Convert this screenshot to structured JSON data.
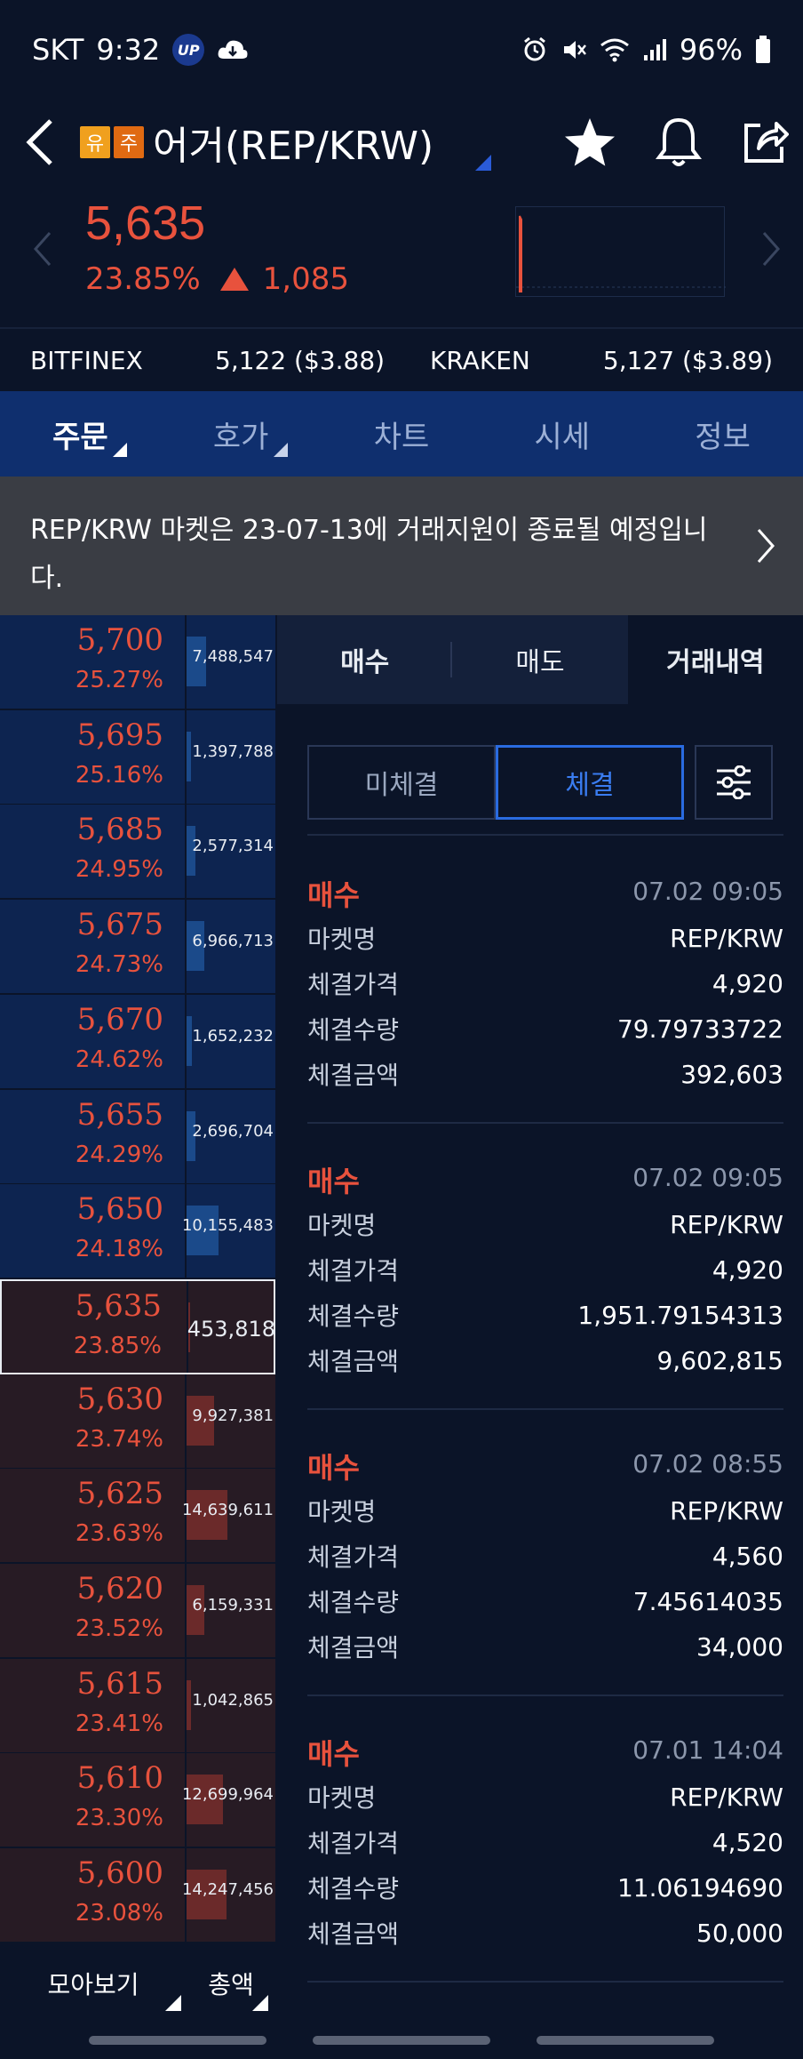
{
  "status": {
    "carrier": "SKT",
    "time": "9:32",
    "up_badge": "UP",
    "battery": "96%"
  },
  "header": {
    "badge1": "유",
    "badge2": "주",
    "title": "어거(REP/KRW)"
  },
  "price": {
    "current": "5,635",
    "change_pct": "23.85%",
    "change_amt": "1,085"
  },
  "exchanges": [
    {
      "name": "BITFINEX",
      "value": "5,122 ($3.88)"
    },
    {
      "name": "KRAKEN",
      "value": "5,127 ($3.89)"
    }
  ],
  "tabs": [
    "주문",
    "호가",
    "차트",
    "시세",
    "정보"
  ],
  "notice": {
    "text": "REP/KRW 마켓은 23-07-13에 거래지원이 종료될 예정입니다."
  },
  "orderbook": [
    {
      "price": "5,700",
      "pct": "25.27%",
      "vol": "7,488,547",
      "side": "ask",
      "bar": 0.22
    },
    {
      "price": "5,695",
      "pct": "25.16%",
      "vol": "1,397,788",
      "side": "ask",
      "bar": 0.05
    },
    {
      "price": "5,685",
      "pct": "24.95%",
      "vol": "2,577,314",
      "side": "ask",
      "bar": 0.1
    },
    {
      "price": "5,675",
      "pct": "24.73%",
      "vol": "6,966,713",
      "side": "ask",
      "bar": 0.2
    },
    {
      "price": "5,670",
      "pct": "24.62%",
      "vol": "1,652,232",
      "side": "ask",
      "bar": 0.06
    },
    {
      "price": "5,655",
      "pct": "24.29%",
      "vol": "2,696,704",
      "side": "ask",
      "bar": 0.1
    },
    {
      "price": "5,650",
      "pct": "24.18%",
      "vol": "10,155,483",
      "side": "ask",
      "bar": 0.35
    },
    {
      "price": "5,635",
      "pct": "23.85%",
      "vol": "453,818",
      "side": "bid",
      "bar": 0.02,
      "current": true
    },
    {
      "price": "5,630",
      "pct": "23.74%",
      "vol": "9,927,381",
      "side": "bid",
      "bar": 0.3
    },
    {
      "price": "5,625",
      "pct": "23.63%",
      "vol": "14,639,611",
      "side": "bid",
      "bar": 0.45
    },
    {
      "price": "5,620",
      "pct": "23.52%",
      "vol": "6,159,331",
      "side": "bid",
      "bar": 0.2
    },
    {
      "price": "5,615",
      "pct": "23.41%",
      "vol": "1,042,865",
      "side": "bid",
      "bar": 0.05
    },
    {
      "price": "5,610",
      "pct": "23.30%",
      "vol": "12,699,964",
      "side": "bid",
      "bar": 0.4
    },
    {
      "price": "5,600",
      "pct": "23.08%",
      "vol": "14,247,456",
      "side": "bid",
      "bar": 0.44
    }
  ],
  "ob_footer": {
    "collect": "모아보기",
    "total": "총액"
  },
  "subtabs": [
    "매수",
    "매도",
    "거래내역"
  ],
  "filters": {
    "pending": "미체결",
    "filled": "체결"
  },
  "trade_labels": {
    "market": "마켓명",
    "price": "체결가격",
    "qty": "체결수량",
    "amount": "체결금액"
  },
  "trades": [
    {
      "type": "매수",
      "time": "07.02 09:05",
      "market": "REP/KRW",
      "price": "4,920",
      "qty": "79.79733722",
      "amount": "392,603"
    },
    {
      "type": "매수",
      "time": "07.02 09:05",
      "market": "REP/KRW",
      "price": "4,920",
      "qty": "1,951.79154313",
      "amount": "9,602,815"
    },
    {
      "type": "매수",
      "time": "07.02 08:55",
      "market": "REP/KRW",
      "price": "4,560",
      "qty": "7.45614035",
      "amount": "34,000"
    },
    {
      "type": "매수",
      "time": "07.01 14:04",
      "market": "REP/KRW",
      "price": "4,520",
      "qty": "11.06194690",
      "amount": "50,000"
    }
  ],
  "colors": {
    "up": "#e8523d",
    "ask_bg": "#0d2450",
    "bid_bg": "#271b24",
    "tab_bg": "#0f2f6e",
    "accent": "#2a6be0"
  }
}
